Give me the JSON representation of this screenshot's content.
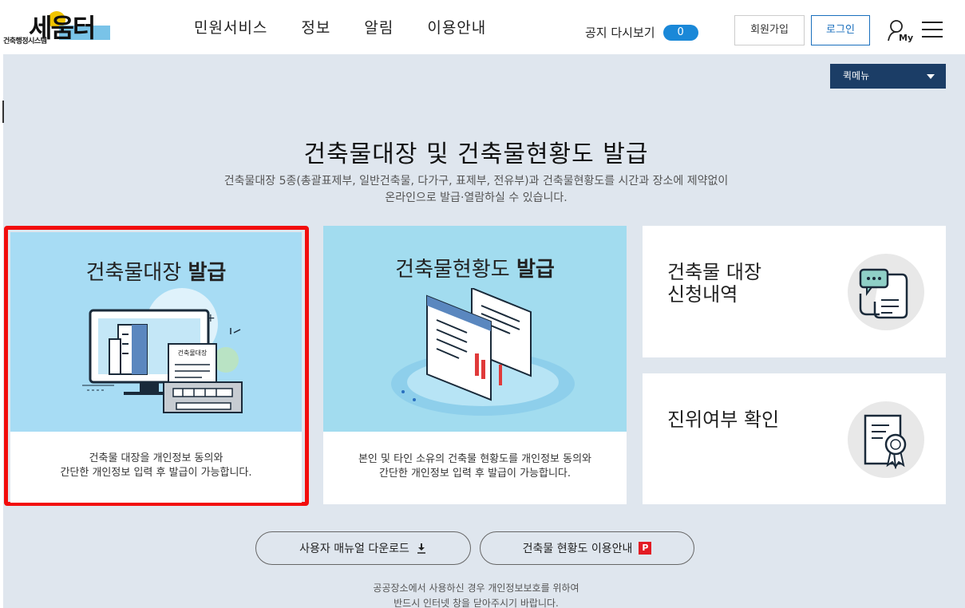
{
  "header": {
    "logo_text": "세움터",
    "logo_sub": "건축행정시스템",
    "nav": [
      "민원서비스",
      "정보",
      "알림",
      "이용안내"
    ],
    "notice_label": "공지 다시보기",
    "notice_count": "0",
    "join_label": "회원가입",
    "login_label": "로그인",
    "my_label": "My"
  },
  "quick_menu": {
    "label": "퀵메뉴"
  },
  "page": {
    "title": "건축물대장 및 건축물현황도 발급",
    "desc_line1": "건축물대장 5종(총괄표제부, 일반건축물, 다가구, 표제부, 전유부)과 건축물현황도를 시간과 장소에 제약없이",
    "desc_line2": "온라인으로 발급·열람하실 수 있습니다."
  },
  "cards": [
    {
      "title_normal": "건축물대장 ",
      "title_bold": "발급",
      "doc_label": "건축물대장",
      "text_line1": "건축물 대장을 개인정보 동의와",
      "text_line2": "간단한 개인정보 입력 후 발급이 가능합니다."
    },
    {
      "title_normal": "건축물현황도 ",
      "title_bold": "발급",
      "text_line1": "본인 및 타인 소유의 건축물 현황도를 개인정보 동의와",
      "text_line2": "간단한 개인정보 입력 후 발급이 가능합니다."
    }
  ],
  "side_cards": [
    {
      "title_line1": "건축물 대장",
      "title_line2": "신청내역",
      "icon": "document-chat-icon"
    },
    {
      "title_line1": "진위여부 확인",
      "icon": "certificate-icon"
    }
  ],
  "buttons": {
    "manual_label": "사용자 매뉴얼 다운로드",
    "guide_label": "건축물 현황도 이용안내",
    "pdf_badge": "P"
  },
  "footer": {
    "line1": "공공장소에서 사용하신 경우 개인정보보호를 위하여",
    "line2": "반드시 인터넷 창을 닫아주시기 바랍니다."
  },
  "colors": {
    "accent_blue": "#1a88d8",
    "quick_menu_bg": "#1b3d66",
    "highlight_red": "#f20d0d",
    "card_visual_bg": "#a7dcf4",
    "page_bg": "#dfe6ee"
  }
}
